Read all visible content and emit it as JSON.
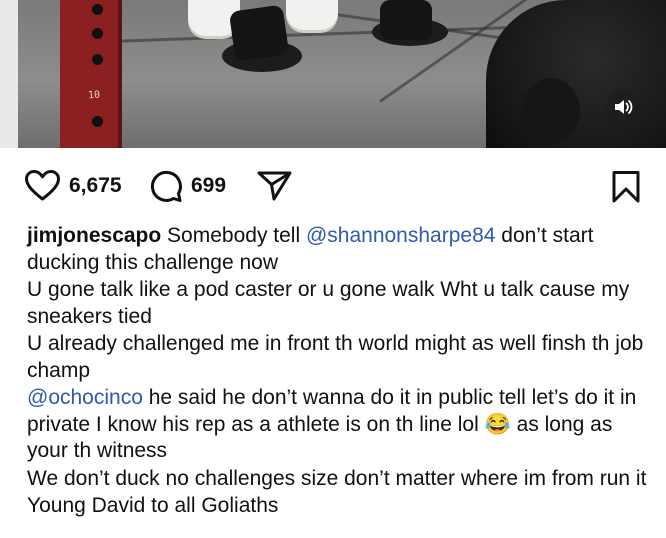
{
  "media": {
    "rack_number": "10",
    "sound_icon": "speaker-sound-icon"
  },
  "actions": {
    "likes": "6,675",
    "comments": "699",
    "icons": [
      "heart-icon",
      "comment-icon",
      "share-icon",
      "bookmark-icon"
    ]
  },
  "caption": {
    "username": "jimjonescapo",
    "line1_a": "Somebody tell ",
    "line1_mention": "@shannonsharpe84",
    "line1_b": " don’t start ducking this challenge now",
    "line2": "U gone talk like a pod caster or u gone walk Wht u talk cause my sneakers tied",
    "line3": "U already challenged me in front th world might as well finsh th job champ",
    "line4_mention": "@ochocinco",
    "line4_a": " he said he don’t wanna do it in public tell let’s do it in private I know his rep as a athlete is on th line lol ",
    "line4_emoji": "😂",
    "line4_b": " as long as your th witness",
    "line5": "We don’t duck no challenges size don’t matter where im from run it",
    "line6": "Young David to all Goliaths"
  },
  "colors": {
    "mention": "#2e5bb0",
    "text": "#111111",
    "rack": "#8c1f22"
  }
}
